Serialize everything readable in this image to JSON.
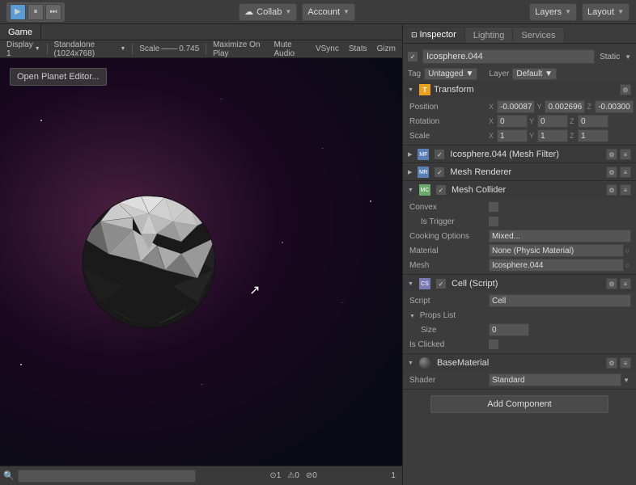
{
  "toolbar": {
    "play_label": "▶",
    "pause_label": "⏸",
    "step_label": "⏭",
    "collab_label": "Collab",
    "account_label": "Account",
    "layers_label": "Layers",
    "layout_label": "Layout"
  },
  "game_view": {
    "tab_label": "Game",
    "display_label": "Display 1",
    "standalone_label": "Standalone (1024x768)",
    "scale_label": "Scale",
    "scale_value": "0.745",
    "maximize_label": "Maximize On Play",
    "mute_audio_label": "Mute Audio",
    "vsync_label": "VSync",
    "stats_label": "Stats",
    "gizmos_label": "Gizm",
    "open_planet_btn": "Open Planet Editor..."
  },
  "inspector": {
    "tab_inspector": "Inspector",
    "tab_lighting": "Lighting",
    "tab_services": "Services",
    "object_name": "Icosphere.044",
    "static_label": "Static",
    "tag_label": "Tag",
    "tag_value": "Untagged",
    "layer_label": "Layer",
    "layer_value": "Default",
    "transform": {
      "title": "Transform",
      "position_label": "Position",
      "pos_x": "-0.00087",
      "pos_y": "0.002696",
      "pos_z": "-0.00300",
      "rotation_label": "Rotation",
      "rot_x": "0",
      "rot_y": "0",
      "rot_z": "0",
      "scale_label": "Scale",
      "scale_x": "1",
      "scale_y": "1",
      "scale_z": "1"
    },
    "mesh_filter": {
      "title": "Icosphere.044 (Mesh Filter)"
    },
    "mesh_renderer": {
      "title": "Mesh Renderer"
    },
    "mesh_collider": {
      "title": "Mesh Collider",
      "convex_label": "Convex",
      "is_trigger_label": "Is Trigger",
      "cooking_label": "Cooking Options",
      "cooking_value": "Mixed...",
      "material_label": "Material",
      "material_value": "None (Physic Material)",
      "mesh_label": "Mesh",
      "mesh_value": "Icosphere.044"
    },
    "cell_script": {
      "title": "Cell (Script)",
      "script_label": "Script",
      "script_value": "Cell",
      "props_list_label": "Props List",
      "size_label": "Size",
      "size_value": "0",
      "is_clicked_label": "Is Clicked"
    },
    "base_material": {
      "title": "BaseMaterial",
      "shader_label": "Shader",
      "shader_value": "Standard"
    },
    "add_component_label": "Add Component"
  }
}
